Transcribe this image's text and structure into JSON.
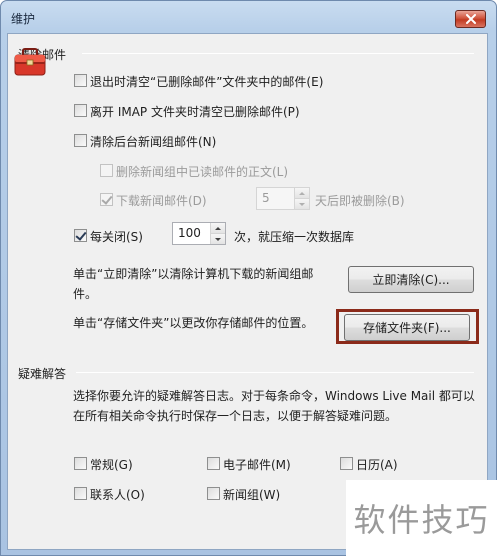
{
  "window": {
    "title": "维护"
  },
  "clean": {
    "heading": "清除邮件",
    "items": [
      {
        "label": "退出时清空“已删除邮件”文件夹中的邮件(E)",
        "checked": false,
        "disabled": false
      },
      {
        "label": "离开 IMAP 文件夹时清空已删除邮件(P)",
        "checked": false,
        "disabled": false
      },
      {
        "label": "清除后台新闻组邮件(N)",
        "checked": false,
        "disabled": false
      },
      {
        "label": "删除新闻组中已读邮件的正文(L)",
        "checked": false,
        "disabled": true
      },
      {
        "label": "下载新闻邮件(D)",
        "checked": true,
        "disabled": true
      }
    ],
    "download_days": {
      "value": "5",
      "suffix": "天后即被删除(B)",
      "disabled": true
    },
    "compact": {
      "label": "每关闭(S)",
      "checked": true,
      "value": "100",
      "suffix": "次，就压缩一次数据库"
    },
    "clean_now": {
      "text": "单击“立即清除”以清除计算机下载的新闻组邮件。",
      "button": "立即清除(C)..."
    },
    "store_folder": {
      "text": "单击“存储文件夹”以更改你存储邮件的位置。",
      "button": "存储文件夹(F)..."
    }
  },
  "troubleshoot": {
    "heading": "疑难解答",
    "description": "选择你要允许的疑难解答日志。对于每条命令，Windows Live Mail 都可以在所有相关命令执行时保存一个日志，以便于解答疑难问题。",
    "options": [
      {
        "label": "常规(G)",
        "checked": false
      },
      {
        "label": "电子邮件(M)",
        "checked": false
      },
      {
        "label": "日历(A)",
        "checked": false
      },
      {
        "label": "联系人(O)",
        "checked": false
      },
      {
        "label": "新闻组(W)",
        "checked": false
      }
    ]
  },
  "watermark": {
    "text": "软件技巧"
  },
  "colors": {
    "highlight_border": "#8b2a1a",
    "close_button": "#c23b22"
  },
  "icons": {
    "close": "close-icon",
    "toolbox": "toolbox-icon"
  }
}
